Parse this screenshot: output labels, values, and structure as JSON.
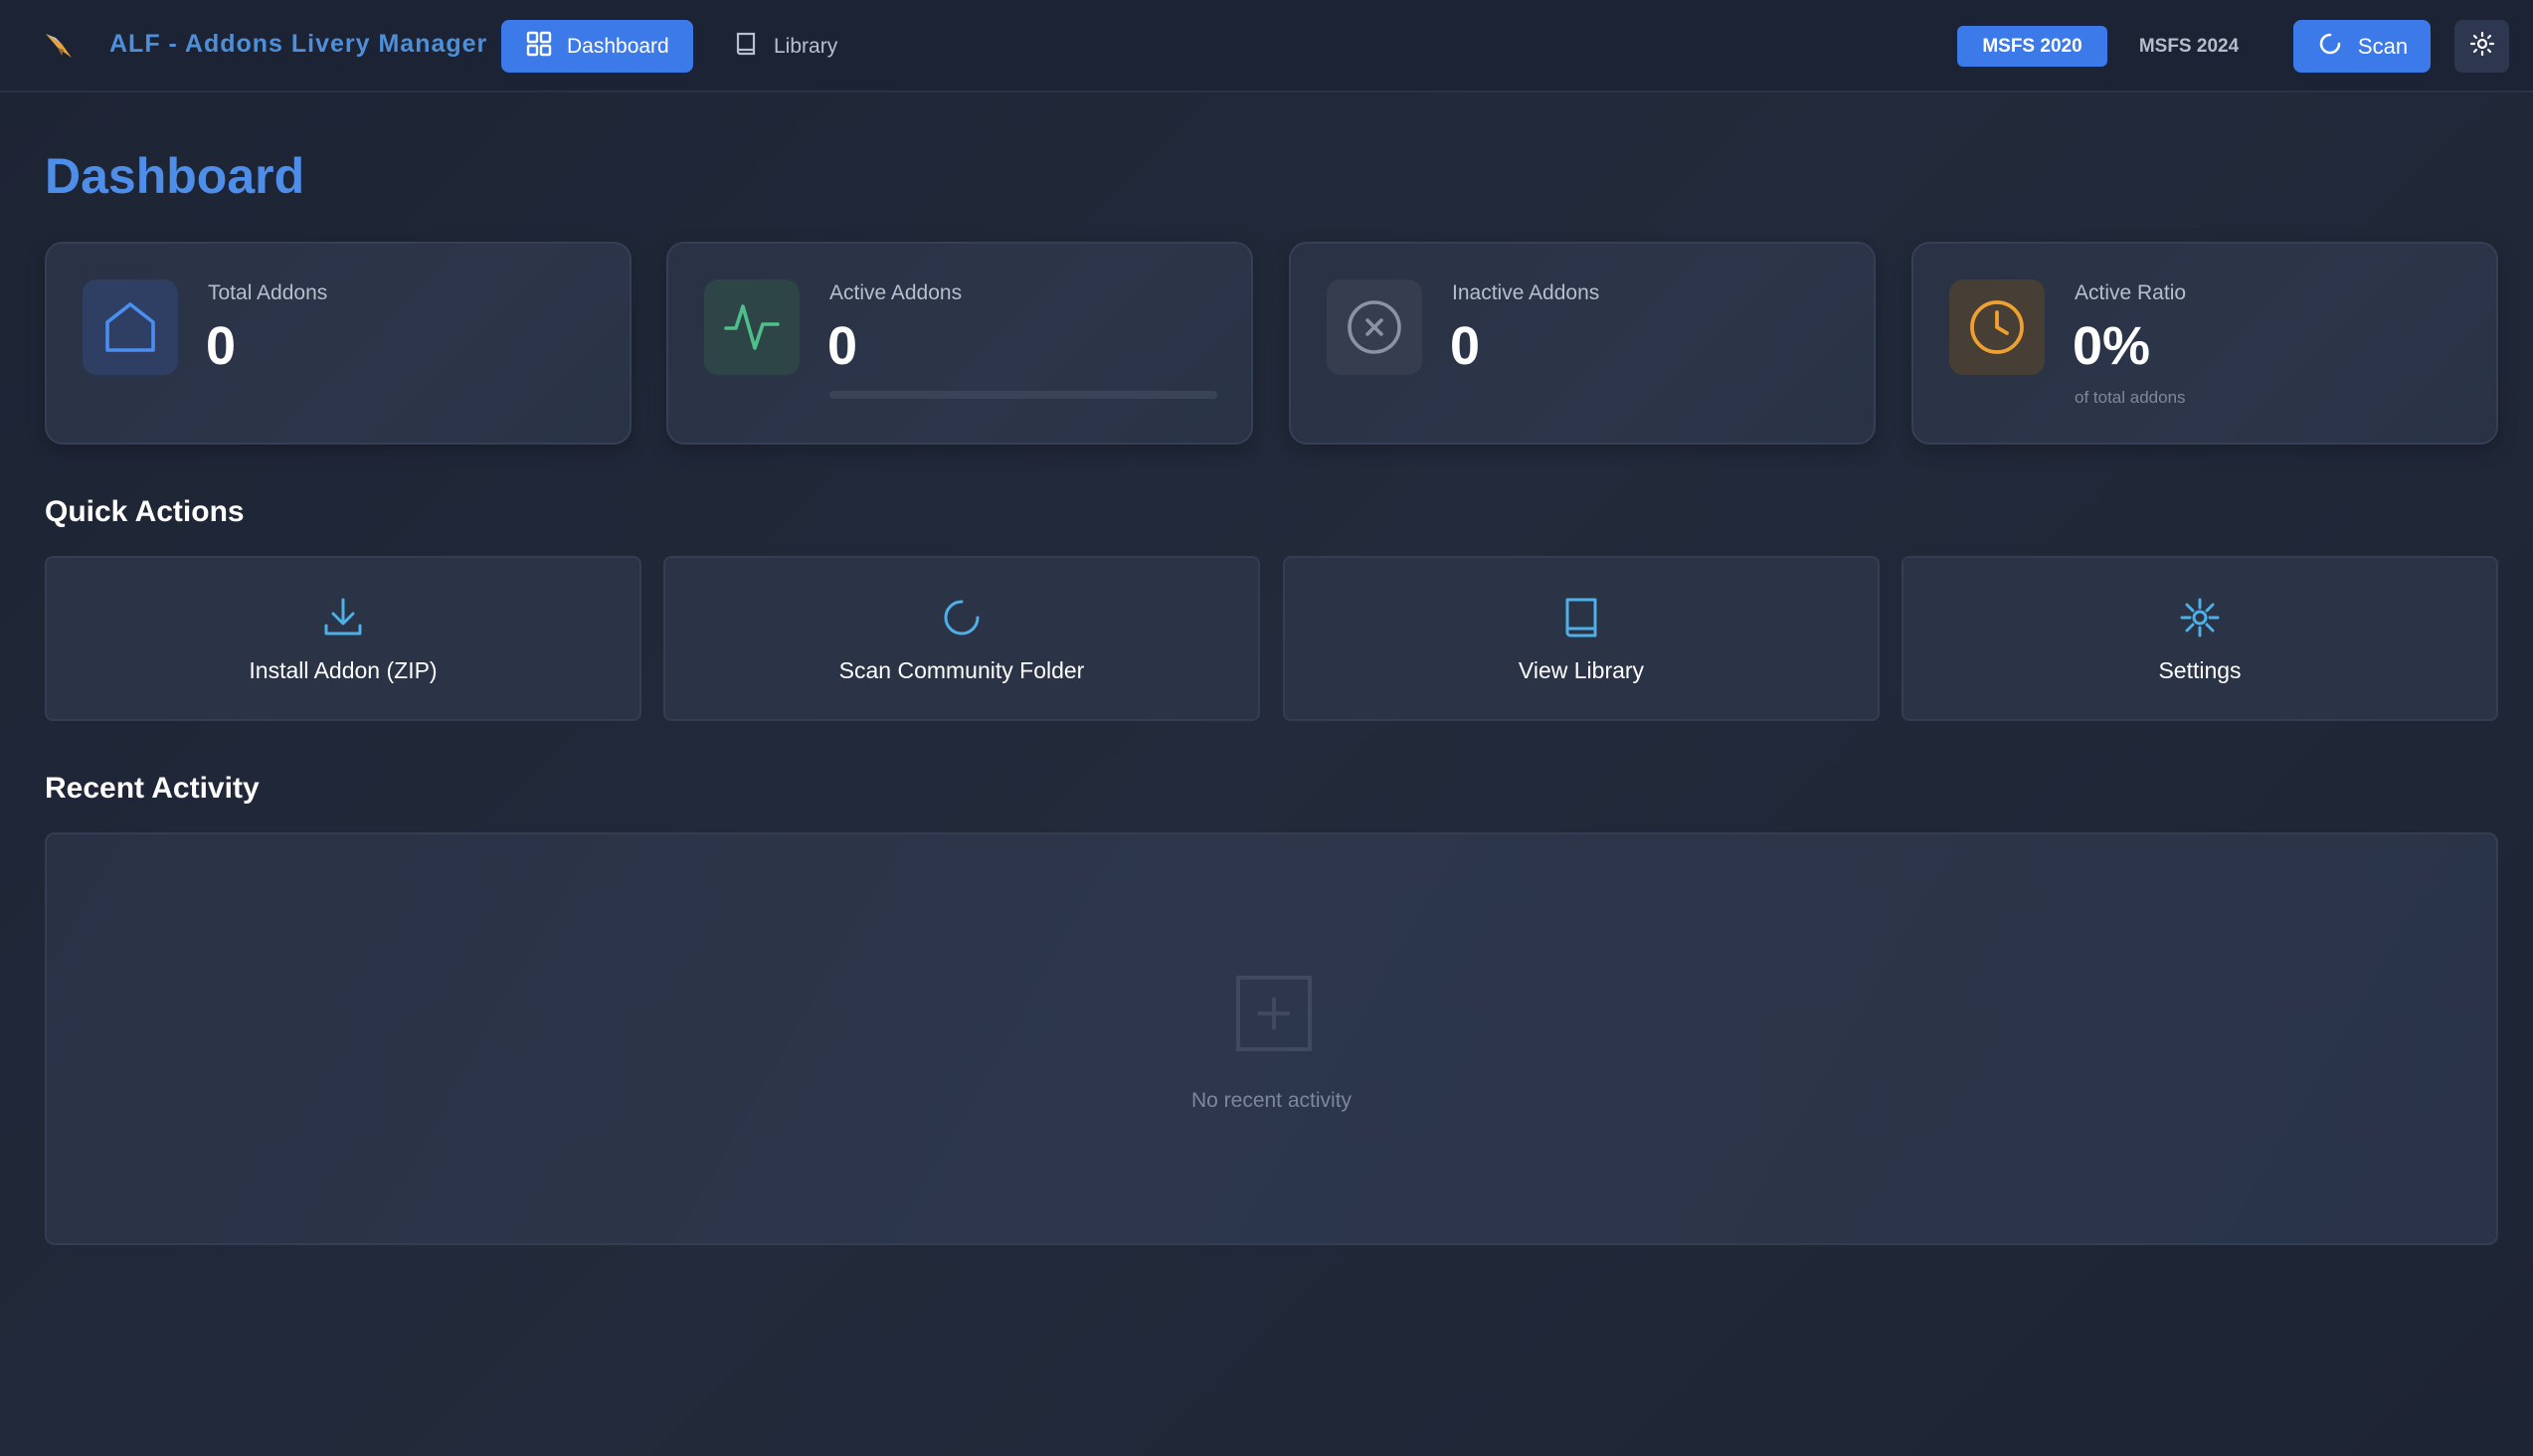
{
  "app": {
    "title": "ALF - Addons Livery Manager"
  },
  "nav": {
    "dashboard_label": "Dashboard",
    "library_label": "Library"
  },
  "sims": {
    "msfs2020_label": "MSFS 2020",
    "msfs2024_label": "MSFS 2024",
    "selected": "MSFS 2020"
  },
  "toolbar": {
    "scan_label": "Scan",
    "theme_icon": "sun-icon"
  },
  "page": {
    "title": "Dashboard"
  },
  "stats": {
    "total": {
      "label": "Total Addons",
      "value": "0",
      "icon": "home-icon",
      "color": "#4a8ef0"
    },
    "active": {
      "label": "Active Addons",
      "value": "0",
      "icon": "activity-icon",
      "color": "#4fbf8a",
      "progress": 0
    },
    "inactive": {
      "label": "Inactive Addons",
      "value": "0",
      "icon": "x-circle-icon",
      "color": "#8b93a3"
    },
    "ratio": {
      "label": "Active Ratio",
      "value": "0%",
      "sub": "of total addons",
      "icon": "clock-icon",
      "color": "#f0a030"
    }
  },
  "quick_actions": {
    "heading": "Quick Actions",
    "items": [
      {
        "label": "Install Addon (ZIP)",
        "icon": "download-icon"
      },
      {
        "label": "Scan Community Folder",
        "icon": "refresh-icon"
      },
      {
        "label": "View Library",
        "icon": "book-icon"
      },
      {
        "label": "Settings",
        "icon": "settings-icon"
      }
    ]
  },
  "recent_activity": {
    "heading": "Recent Activity",
    "empty_text": "No recent activity",
    "empty_icon": "plus-square-icon"
  },
  "colors": {
    "accent": "#3b7ae8",
    "icon_blue": "#4fb0e8",
    "background": "#1f2637"
  }
}
